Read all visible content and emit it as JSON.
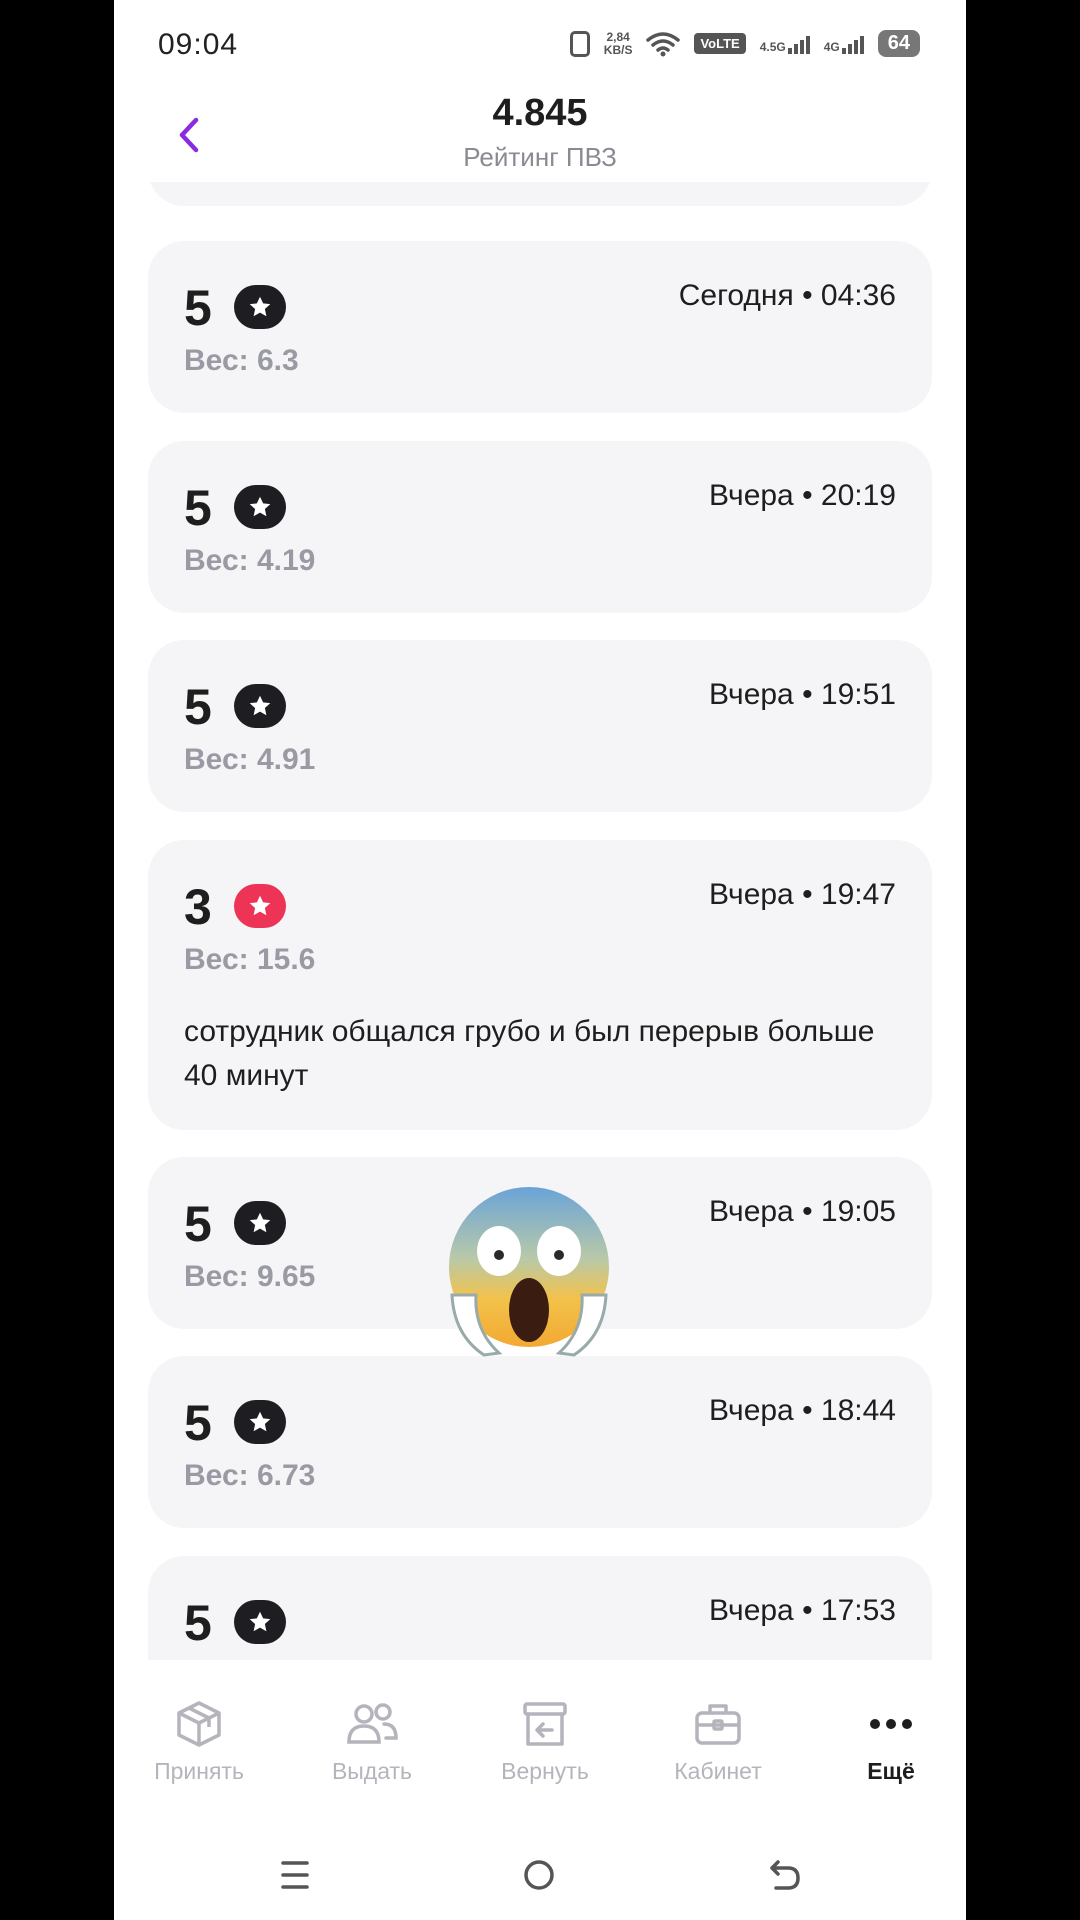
{
  "status_bar": {
    "time": "09:04",
    "speed_top": "2,84",
    "speed_unit": "KB/S",
    "volte": "VoLTE",
    "sim1": "1",
    "net1": "4.5G",
    "net2": "4G",
    "battery": "64"
  },
  "header": {
    "rating": "4.845",
    "subtitle": "Рейтинг ПВЗ",
    "back_icon": "chevron-left-icon",
    "accent_color": "#8a2be2"
  },
  "reviews": [
    {
      "score": "5",
      "star": "dark",
      "weight": "Вес: 6.3",
      "when": "Сегодня • 04:36",
      "comment": ""
    },
    {
      "score": "5",
      "star": "dark",
      "weight": "Вес: 4.19",
      "when": "Вчера • 20:19",
      "comment": ""
    },
    {
      "score": "5",
      "star": "dark",
      "weight": "Вес: 4.91",
      "when": "Вчера • 19:51",
      "comment": ""
    },
    {
      "score": "3",
      "star": "red",
      "weight": "Вес: 15.6",
      "when": "Вчера • 19:47",
      "comment": "сотрудник общался грубо и был перерыв больше 40 минут"
    },
    {
      "score": "5",
      "star": "dark",
      "weight": "Вес: 9.65",
      "when": "Вчера • 19:05",
      "comment": ""
    },
    {
      "score": "5",
      "star": "dark",
      "weight": "Вес: 6.73",
      "when": "Вчера • 18:44",
      "comment": ""
    },
    {
      "score": "5",
      "star": "dark",
      "weight": "",
      "when": "Вчера • 17:53",
      "comment": ""
    }
  ],
  "tabs": [
    {
      "label": "Принять",
      "icon": "box-icon"
    },
    {
      "label": "Выдать",
      "icon": "users-icon"
    },
    {
      "label": "Вернуть",
      "icon": "return-box-icon"
    },
    {
      "label": "Кабинет",
      "icon": "briefcase-icon"
    },
    {
      "label": "Ещё",
      "icon": "more-icon",
      "active": true
    }
  ],
  "colors": {
    "star_dark": "#1e1e22",
    "star_red": "#ee3456",
    "card_bg": "#f5f5f7"
  }
}
